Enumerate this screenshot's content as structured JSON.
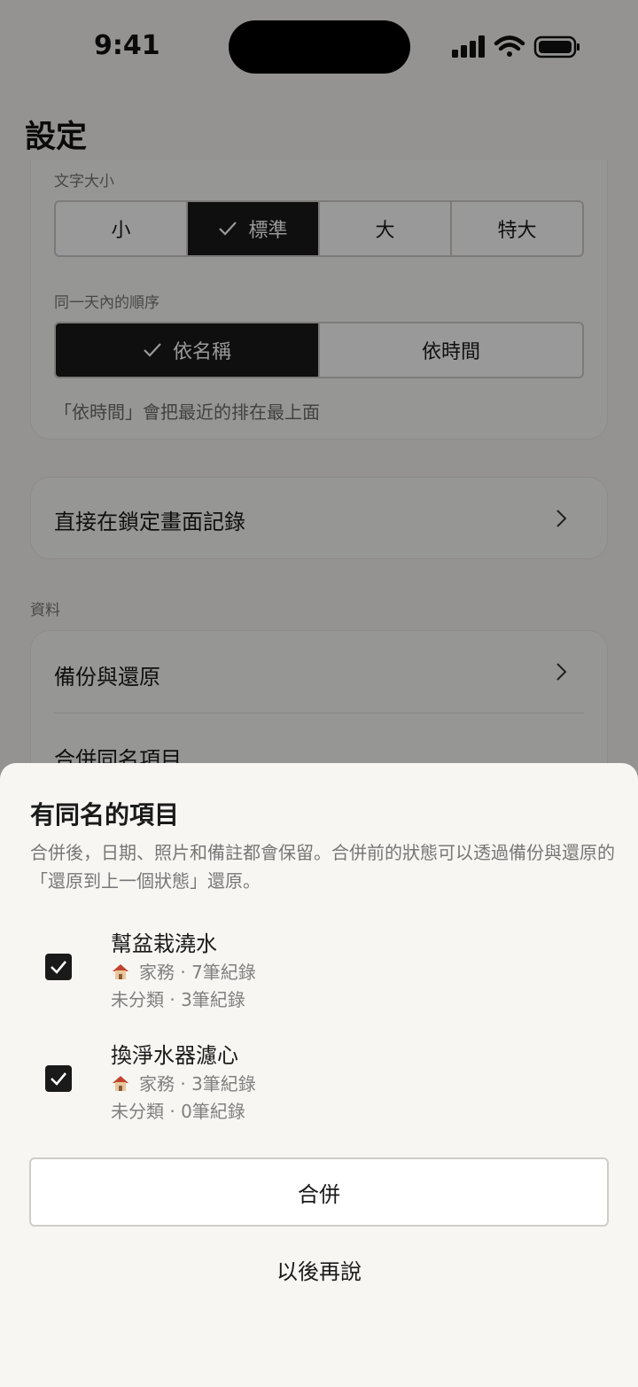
{
  "status_bar": {
    "time": "9:41"
  },
  "page": {
    "title": "設定"
  },
  "display": {
    "text_size_label": "文字大小",
    "text_size_options": [
      "小",
      "標準",
      "大",
      "特大"
    ],
    "text_size_selected": "標準",
    "order_label": "同一天內的順序",
    "order_options": [
      "依名稱",
      "依時間"
    ],
    "order_selected": "依名稱",
    "order_helper": "「依時間」會把最近的排在最上面"
  },
  "lock_screen": {
    "label": "直接在鎖定畫面記錄"
  },
  "data_section": {
    "label": "資料",
    "items": [
      {
        "label": "備份與還原"
      },
      {
        "label": "合併同名項目"
      }
    ]
  },
  "sheet": {
    "title": "有同名的項目",
    "description": "合併後，日期、照片和備註都會保留。合併前的狀態可以透過備份與還原的「還原到上一個狀態」還原。",
    "items": [
      {
        "name": "幫盆栽澆水",
        "checked": true,
        "category_icon": "house-icon",
        "line1": "家務 · 7筆紀錄",
        "line2": "未分類 · 3筆紀錄"
      },
      {
        "name": "換淨水器濾心",
        "checked": true,
        "category_icon": "house-icon",
        "line1": "家務 · 3筆紀錄",
        "line2": "未分類 · 0筆紀錄"
      }
    ],
    "merge_label": "合併",
    "later_label": "以後再說"
  }
}
